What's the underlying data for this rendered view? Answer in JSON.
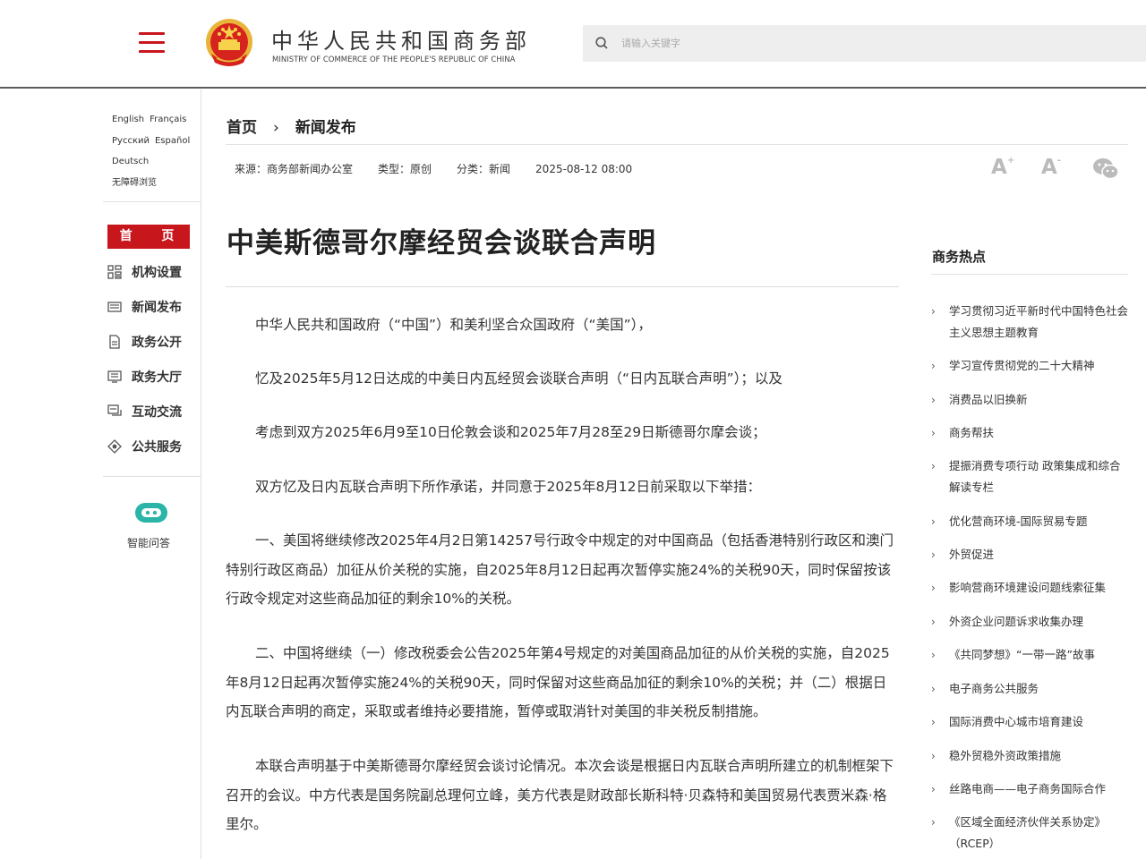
{
  "header": {
    "site_title_cn": "中华人民共和国商务部",
    "site_title_en": "MINISTRY OF COMMERCE OF THE PEOPLE'S REPUBLIC OF CHINA",
    "search_placeholder": "请输入关键字"
  },
  "languages": {
    "english": "English",
    "french": "Français",
    "russian": "Русский",
    "spanish": "Español",
    "german": "Deutsch",
    "accessibility": "无障碍浏览"
  },
  "nav": {
    "home": "首 页",
    "items": [
      {
        "label": "机构设置",
        "icon": "org-chart-icon"
      },
      {
        "label": "新闻发布",
        "icon": "newspaper-icon"
      },
      {
        "label": "政务公开",
        "icon": "document-icon"
      },
      {
        "label": "政务大厅",
        "icon": "service-hall-icon"
      },
      {
        "label": "互动交流",
        "icon": "chat-icon"
      },
      {
        "label": "公共服务",
        "icon": "public-service-icon"
      }
    ],
    "robot_label": "智能问答"
  },
  "breadcrumb": {
    "home": "首页",
    "separator": "›",
    "current": "新闻发布"
  },
  "meta": {
    "source": "来源：商务部新闻办公室",
    "type": "类型：原创",
    "category": "分类：新闻",
    "date": "2025-08-12 08:00"
  },
  "tools": {
    "font_large": "A",
    "font_small": "A",
    "font_large_sup": "+",
    "font_small_sup": "-"
  },
  "article": {
    "title": "中美斯德哥尔摩经贸会谈联合声明",
    "paragraphs": [
      "中华人民共和国政府（“中国”）和美利坚合众国政府（“美国”），",
      "忆及2025年5月12日达成的中美日内瓦经贸会谈联合声明（“日内瓦联合声明”）；以及",
      "考虑到双方2025年6月9至10日伦敦会谈和2025年7月28至29日斯德哥尔摩会谈；",
      "双方忆及日内瓦联合声明下所作承诺，并同意于2025年8月12日前采取以下举措：",
      "一、美国将继续修改2025年4月2日第14257号行政令中规定的对中国商品（包括香港特别行政区和澳门特别行政区商品）加征从价关税的实施，自2025年8月12日起再次暂停实施24%的关税90天，同时保留按该行政令规定对这些商品加征的剩余10%的关税。",
      "二、中国将继续（一）修改税委会公告2025年第4号规定的对美国商品加征的从价关税的实施，自2025年8月12日起再次暂停实施24%的关税90天，同时保留对这些商品加征的剩余10%的关税；并（二）根据日内瓦联合声明的商定，采取或者维持必要措施，暂停或取消针对美国的非关税反制措施。",
      "本联合声明基于中美斯德哥尔摩经贸会谈讨论情况。本次会谈是根据日内瓦联合声明所建立的机制框架下召开的会议。中方代表是国务院副总理何立峰，美方代表是财政部长斯科特·贝森特和美国贸易代表贾米森·格里尔。"
    ]
  },
  "hot": {
    "title": "商务热点",
    "items": [
      "学习贯彻习近平新时代中国特色社会主义思想主题教育",
      "学习宣传贯彻党的二十大精神",
      "消费品以旧换新",
      "商务帮扶",
      "提振消费专项行动 政策集成和综合解读专栏",
      "优化营商环境-国际贸易专题",
      "外贸促进",
      "影响营商环境建设问题线索征集",
      "外资企业问题诉求收集办理",
      "《共同梦想》“一带一路”故事",
      "电子商务公共服务",
      "国际消费中心城市培育建设",
      "稳外贸稳外资政策措施",
      "丝路电商——电子商务国际合作",
      "《区域全面经济伙伴关系协定》（RCEP）"
    ]
  },
  "colors": {
    "brand_red": "#c8161d",
    "robot_teal": "#2bb5a8"
  }
}
